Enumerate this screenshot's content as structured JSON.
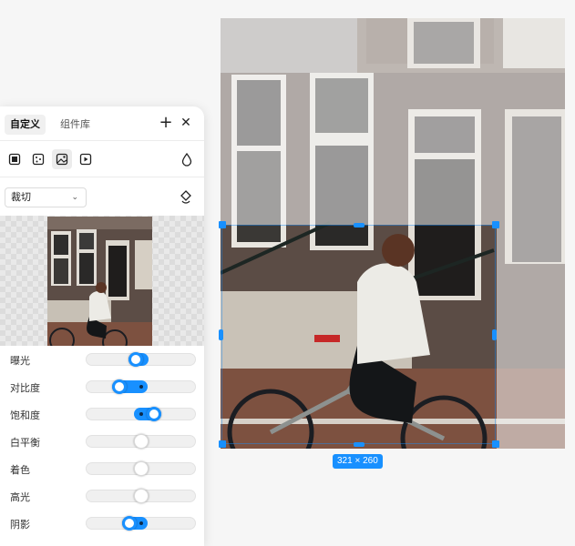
{
  "panel": {
    "tabs": [
      {
        "label": "自定义",
        "active": true
      },
      {
        "label": "组件库",
        "active": false
      }
    ],
    "add_icon": "plus-icon",
    "close_icon": "close-icon",
    "tools": [
      "frame-icon",
      "grain-icon",
      "image-icon",
      "play-icon"
    ],
    "drop_icon": "droplet-icon",
    "mode": {
      "value": "裁切"
    },
    "rotate_icon": "rotate-icon"
  },
  "adjustments": [
    {
      "label": "曝光",
      "value": 0.45
    },
    {
      "label": "对比度",
      "value": 0.28
    },
    {
      "label": "饱和度",
      "value": 0.64
    },
    {
      "label": "白平衡",
      "value": 0.5
    },
    {
      "label": "着色",
      "value": 0.5
    },
    {
      "label": "高光",
      "value": 0.5
    },
    {
      "label": "阴影",
      "value": 0.38
    }
  ],
  "canvas": {
    "size_badge": "321 × 260"
  },
  "colors": {
    "accent": "#1890ff"
  }
}
